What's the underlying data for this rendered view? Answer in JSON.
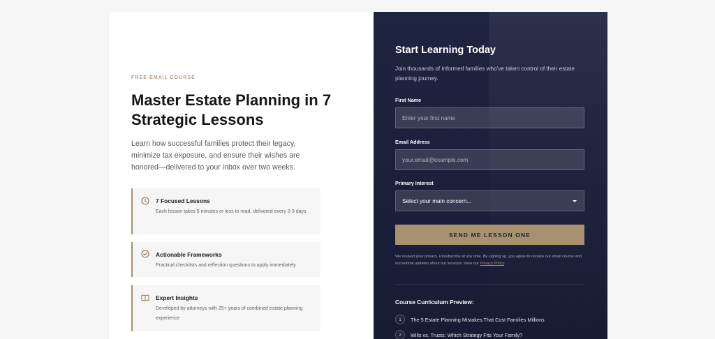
{
  "intro": {
    "eyebrow": "FREE EMAIL COURSE",
    "headline": "Master Estate Planning in 7 Strategic Lessons",
    "subcopy": "Learn how successful families protect their legacy, minimize tax exposure, and ensure their wishes are honored—delivered to your inbox over two weeks."
  },
  "features": [
    {
      "icon": "clock-icon",
      "title": "7 Focused Lessons",
      "description": "Each lesson takes 5 minutes or less to read, delivered every 2-3 days"
    },
    {
      "icon": "check-circle-icon",
      "title": "Actionable Frameworks",
      "description": "Practical checklists and reflection questions to apply immediately"
    },
    {
      "icon": "book-icon",
      "title": "Expert Insights",
      "description": "Developed by attorneys with 25+ years of combined estate planning experience"
    }
  ],
  "form": {
    "title": "Start Learning Today",
    "subtitle": "Join thousands of informed families who've taken control of their estate planning journey.",
    "first_name_label": "First Name",
    "first_name_placeholder": "Enter your first name",
    "email_label": "Email Address",
    "email_placeholder": "your.email@example.com",
    "interest_label": "Primary Interest",
    "interest_selected": "Select your main concern...",
    "submit_label": "SEND ME LESSON ONE",
    "privacy_text": "We respect your privacy. Unsubscribe at any time. By signing up, you agree to receive our email course and occasional updates about our services. View our",
    "privacy_link": "Privacy Policy",
    "privacy_end": "."
  },
  "curriculum": {
    "title": "Course Curriculum Preview:",
    "items": [
      {
        "number": "1",
        "text": "The 5 Estate Planning Mistakes That Cost Families Millions"
      },
      {
        "number": "2",
        "text": "Wills vs. Trusts: Which Strategy Fits Your Family?"
      }
    ]
  },
  "colors": {
    "accent": "#a8916e",
    "navy": "#1c2039",
    "page_background": "#f6f6f6"
  }
}
